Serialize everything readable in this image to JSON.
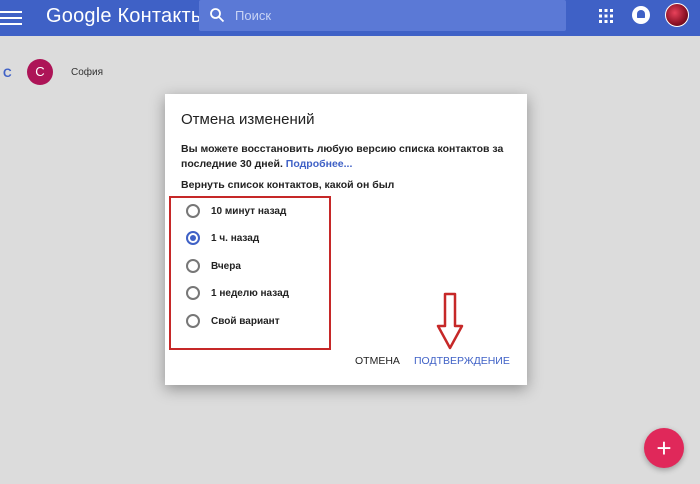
{
  "header": {
    "brand": "Google Контакты",
    "search_placeholder": "Поиск"
  },
  "contacts": {
    "section_letter": "С",
    "items": [
      {
        "initial": "С",
        "name": "София"
      }
    ]
  },
  "dialog": {
    "title": "Отмена изменений",
    "description": "Вы можете восстановить любую версию списка контактов за последние 30 дней.",
    "more_link": "Подробнее...",
    "subtitle": "Вернуть список контактов, какой он был",
    "options": [
      {
        "label": "10 минут назад",
        "checked": false
      },
      {
        "label": "1 ч. назад",
        "checked": true
      },
      {
        "label": "Вчера",
        "checked": false
      },
      {
        "label": "1 неделю назад",
        "checked": false
      },
      {
        "label": "Свой вариант",
        "checked": false
      }
    ],
    "cancel_label": "ОТМЕНА",
    "confirm_label": "ПОДТВЕРЖДЕНИЕ"
  },
  "fab": {
    "label": "+"
  },
  "colors": {
    "header": "#3f61c6",
    "accent": "#3f61c6",
    "annotation": "#c62828",
    "fab": "#e0285a"
  }
}
